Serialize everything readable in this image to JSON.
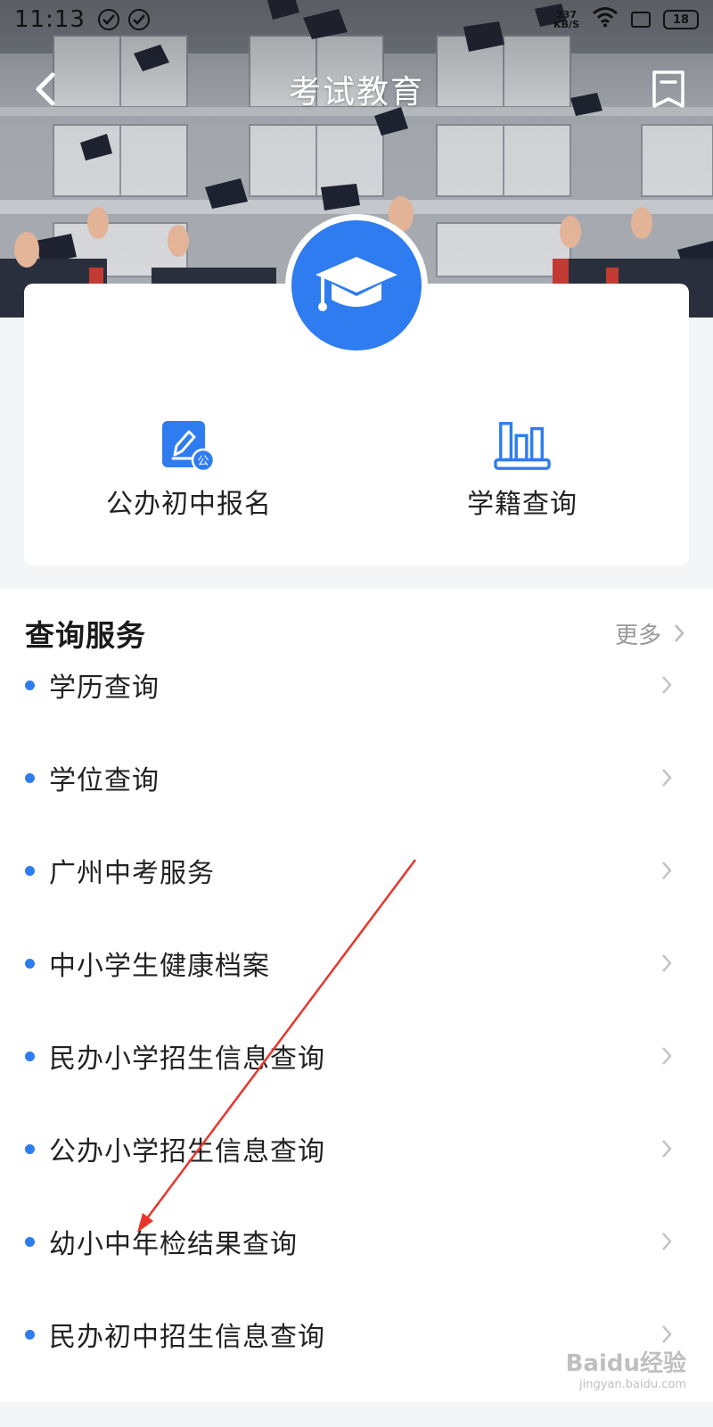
{
  "status_bar": {
    "time": "11:13",
    "net_speed_value": "237",
    "net_speed_unit": "KB/S",
    "battery": "18"
  },
  "nav": {
    "title": "考试教育"
  },
  "quick_entries": [
    {
      "label": "公办初中报名",
      "icon": "edit-badge-icon"
    },
    {
      "label": "学籍查询",
      "icon": "bar-chart-icon"
    }
  ],
  "service_section": {
    "title": "查询服务",
    "more_label": "更多",
    "items": [
      {
        "label": "学历查询"
      },
      {
        "label": "学位查询"
      },
      {
        "label": "广州中考服务"
      },
      {
        "label": "中小学生健康档案"
      },
      {
        "label": "民办小学招生信息查询"
      },
      {
        "label": "公办小学招生信息查询"
      },
      {
        "label": "幼小中年检结果查询"
      },
      {
        "label": "民办初中招生信息查询"
      }
    ]
  },
  "colors": {
    "accent": "#2e7cf0",
    "annotation_arrow": "#e8352c"
  },
  "watermark": {
    "text": "Baidu经验",
    "sub": "jingyan.baidu.com"
  }
}
